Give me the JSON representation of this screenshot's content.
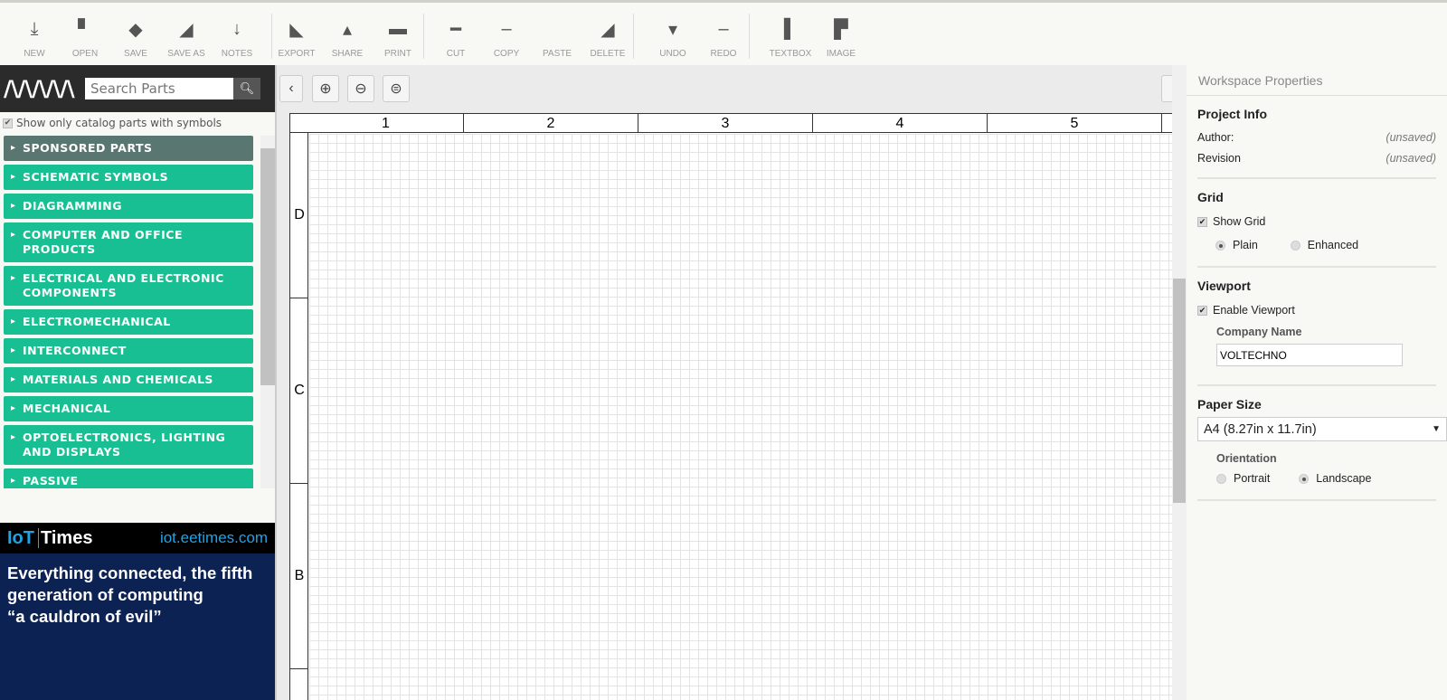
{
  "toolbar": {
    "groups": [
      [
        {
          "label": "NEW",
          "icon": "download-icon"
        },
        {
          "label": "OPEN",
          "icon": "folder-icon"
        },
        {
          "label": "SAVE",
          "icon": "save-icon"
        },
        {
          "label": "SAVE AS",
          "icon": "save-as-icon"
        },
        {
          "label": "NOTES",
          "icon": "notes-icon"
        }
      ],
      [
        {
          "label": "EXPORT",
          "icon": "export-icon"
        },
        {
          "label": "SHARE",
          "icon": "share-icon"
        },
        {
          "label": "PRINT",
          "icon": "print-icon"
        }
      ],
      [
        {
          "label": "CUT",
          "icon": "cut-icon"
        },
        {
          "label": "COPY",
          "icon": "copy-icon"
        },
        {
          "label": "PASTE",
          "icon": "paste-icon"
        },
        {
          "label": "DELETE",
          "icon": "delete-icon"
        }
      ],
      [
        {
          "label": "UNDO",
          "icon": "undo-icon"
        },
        {
          "label": "REDO",
          "icon": "redo-icon"
        }
      ],
      [
        {
          "label": "TEXTBOX",
          "icon": "textbox-icon"
        },
        {
          "label": "IMAGE",
          "icon": "image-icon"
        }
      ]
    ]
  },
  "left": {
    "logo": "ARROW",
    "search_placeholder": "Search Parts",
    "catalog_filter": "Show only catalog parts with symbols",
    "catalog_filter_checked": true,
    "categories": [
      "SPONSORED PARTS",
      "SCHEMATIC SYMBOLS",
      "DIAGRAMMING",
      "COMPUTER AND OFFICE PRODUCTS",
      "ELECTRICAL AND ELECTRONIC COMPONENTS",
      "ELECTROMECHANICAL",
      "INTERCONNECT",
      "MATERIALS AND CHEMICALS",
      "MECHANICAL",
      "OPTOELECTRONICS, LIGHTING AND DISPLAYS",
      "PASSIVE"
    ]
  },
  "ad": {
    "brand_a": "IoT",
    "brand_b": "Times",
    "url": "iot.eetimes.com",
    "line1": "Everything connected, the fifth",
    "line2": "generation of computing",
    "line3": "“a cauldron of evil”"
  },
  "canvas": {
    "columns": [
      "1",
      "2",
      "3",
      "4",
      "5"
    ],
    "rows": [
      "D",
      "C",
      "B"
    ]
  },
  "props": {
    "title": "Workspace Properties",
    "project_info": "Project Info",
    "author_label": "Author:",
    "author_value": "(unsaved)",
    "revision_label": "Revision",
    "revision_value": "(unsaved)",
    "grid": "Grid",
    "show_grid": "Show Grid",
    "plain": "Plain",
    "enhanced": "Enhanced",
    "viewport": "Viewport",
    "enable_viewport": "Enable Viewport",
    "company_label": "Company Name",
    "company_value": "VOLTECHNO",
    "paper_size": "Paper Size",
    "paper_value": "A4 (8.27in x 11.7in)",
    "orientation": "Orientation",
    "portrait": "Portrait",
    "landscape": "Landscape"
  }
}
